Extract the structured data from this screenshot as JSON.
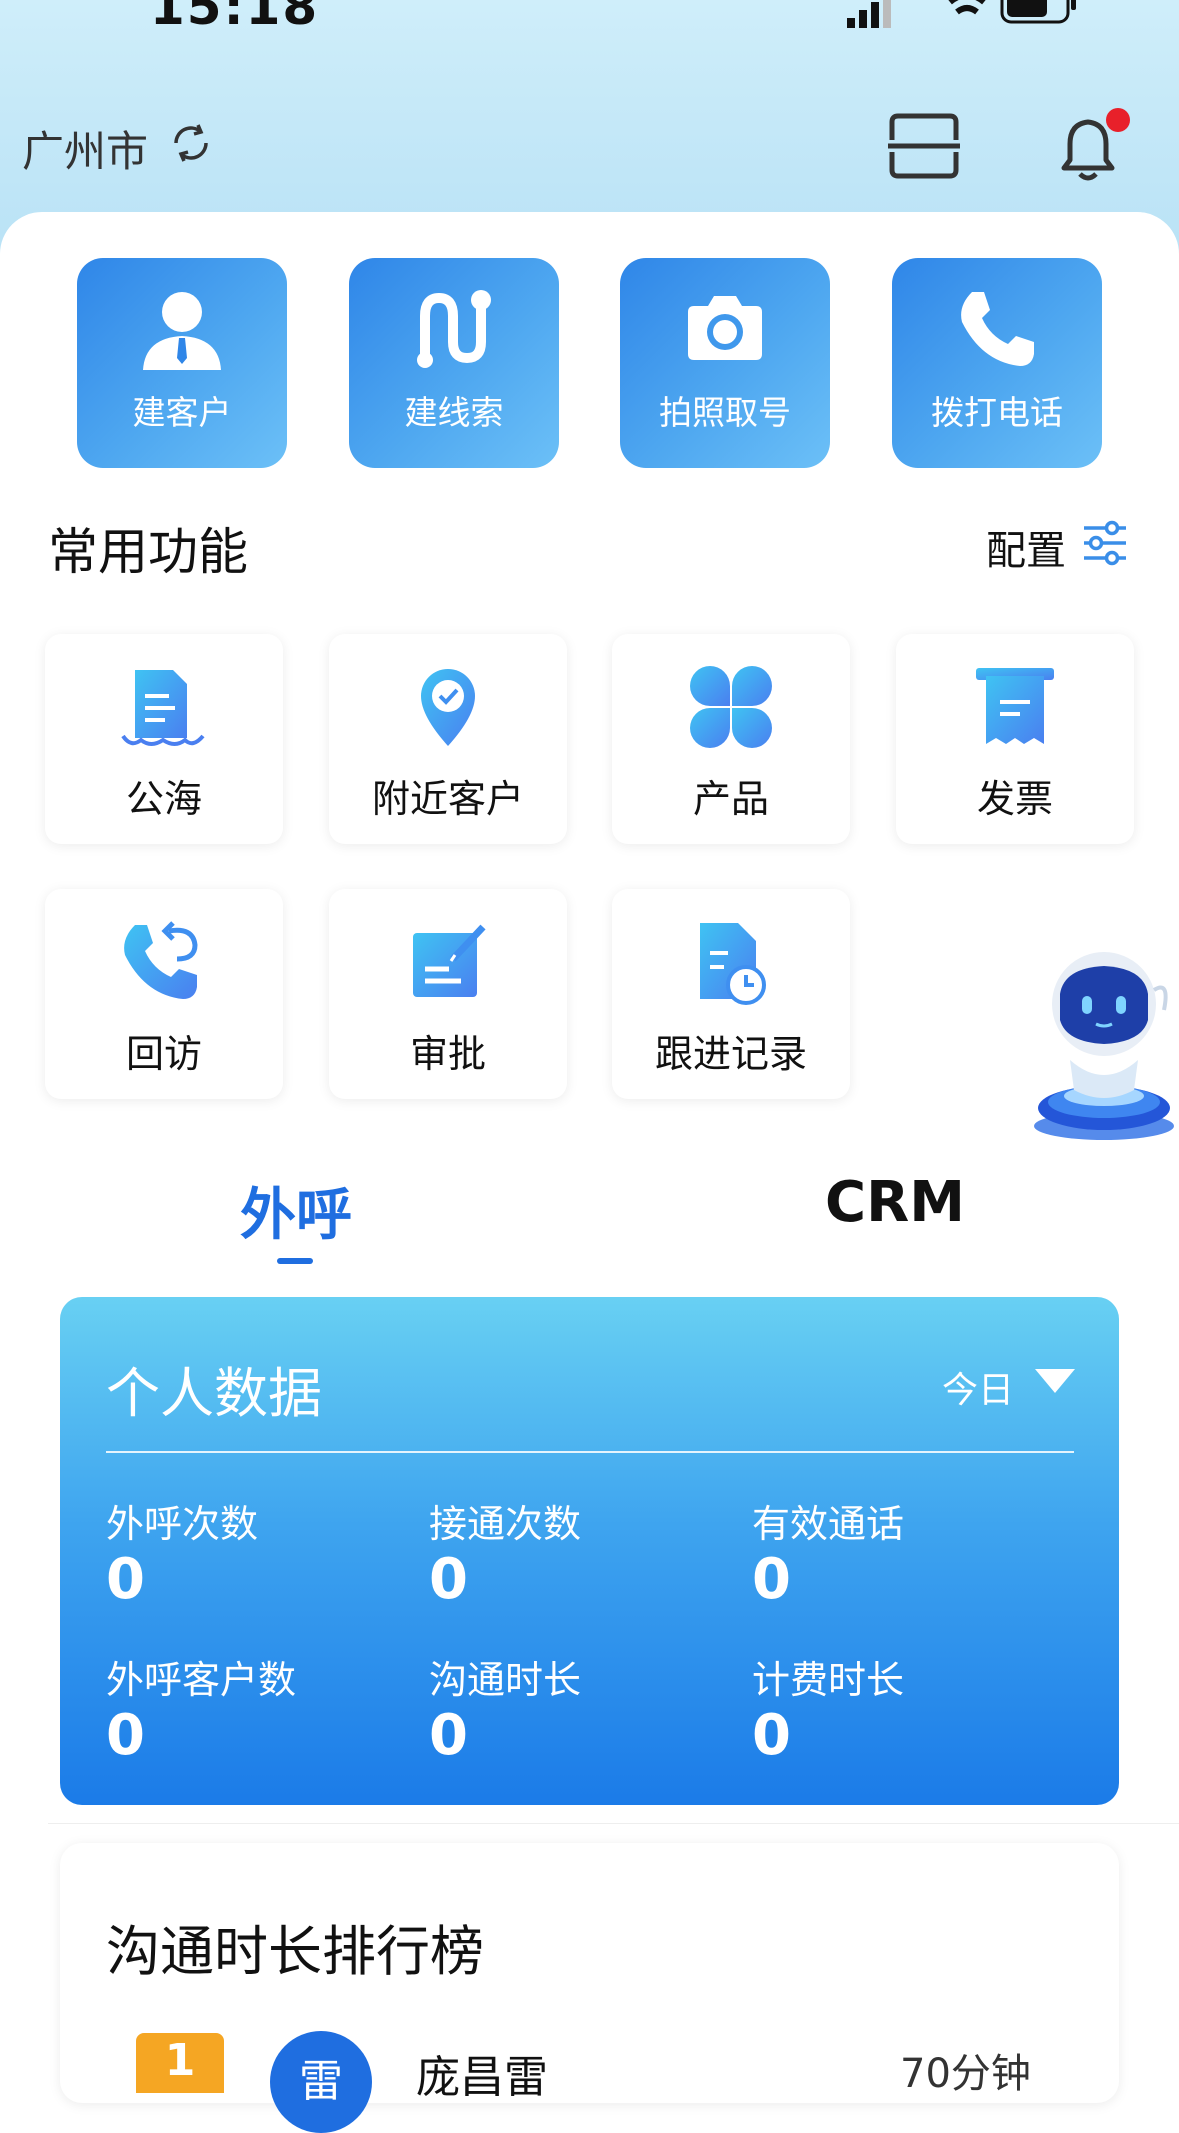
{
  "status_bar": {
    "time": "15:18"
  },
  "header": {
    "city": "广州市"
  },
  "quick_actions": [
    {
      "label": "建客户",
      "icon": "user-tie-icon"
    },
    {
      "label": "建线索",
      "icon": "route-icon"
    },
    {
      "label": "拍照取号",
      "icon": "camera-icon"
    },
    {
      "label": "拨打电话",
      "icon": "phone-icon"
    }
  ],
  "common_functions": {
    "title": "常用功能",
    "config_label": "配置",
    "items": [
      {
        "label": "公海",
        "icon": "document-icon"
      },
      {
        "label": "附近客户",
        "icon": "location-pin-icon"
      },
      {
        "label": "产品",
        "icon": "clover-icon"
      },
      {
        "label": "发票",
        "icon": "receipt-icon"
      },
      {
        "label": "回访",
        "icon": "callback-phone-icon"
      },
      {
        "label": "审批",
        "icon": "edit-icon"
      },
      {
        "label": "跟进记录",
        "icon": "record-clock-icon"
      }
    ]
  },
  "tabs": [
    {
      "label": "外呼",
      "active": true
    },
    {
      "label": "CRM",
      "active": false
    }
  ],
  "personal_data": {
    "title": "个人数据",
    "period": "今日",
    "stats": [
      {
        "label": "外呼次数",
        "value": "0"
      },
      {
        "label": "接通次数",
        "value": "0"
      },
      {
        "label": "有效通话",
        "value": "0"
      },
      {
        "label": "外呼客户数",
        "value": "0"
      },
      {
        "label": "沟通时长",
        "value": "0"
      },
      {
        "label": "计费时长",
        "value": "0"
      }
    ]
  },
  "ranking": {
    "title": "沟通时长排行榜",
    "first": {
      "rank": "1",
      "avatar_char": "雷",
      "name": "庞昌雷",
      "duration": "70分钟"
    }
  },
  "colors": {
    "accent": "#1f6ee0",
    "quick_action_gradient_start": "#2f86e8",
    "quick_action_gradient_end": "#6cc0f7",
    "notification_dot": "#e8202a",
    "rank_gold": "#f5a623"
  }
}
